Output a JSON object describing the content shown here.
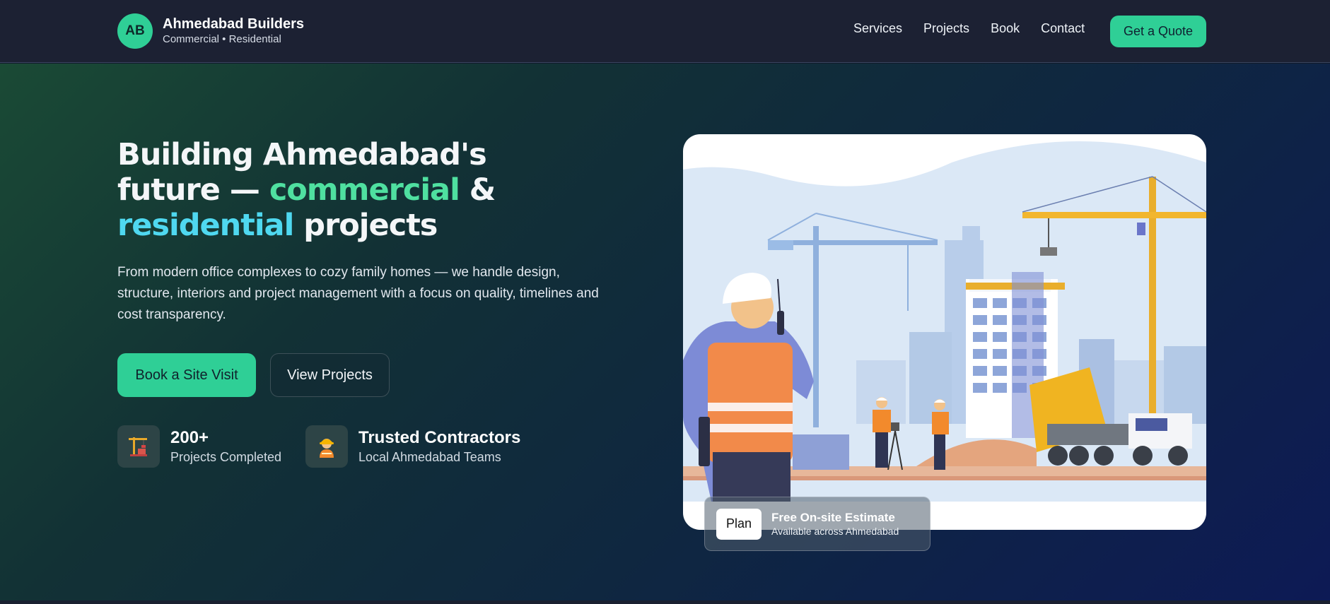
{
  "header": {
    "logo_initials": "AB",
    "brand_name": "Ahmedabad Builders",
    "brand_tagline": "Commercial • Residential",
    "nav": [
      "Services",
      "Projects",
      "Book",
      "Contact"
    ],
    "cta": "Get a Quote"
  },
  "hero": {
    "headline_1": "Building Ahmedabad's",
    "headline_2a": "future — ",
    "headline_2b": "commercial",
    "headline_2c": " &",
    "headline_3a": "residential",
    "headline_3b": " projects",
    "description": "From modern office complexes to cozy family homes — we handle design, structure, interiors and project management with a focus on quality, timelines and cost transparency.",
    "primary_button": "Book a Site Visit",
    "secondary_button": "View Projects",
    "stats": [
      {
        "icon": "construction-crane-icon",
        "value": "200+",
        "label": "Projects Completed"
      },
      {
        "icon": "construction-worker-icon",
        "value": "Trusted Contractors",
        "label": "Local Ahmedabad Teams"
      }
    ]
  },
  "illustration": {
    "icon": "construction-site-illustration"
  },
  "badge": {
    "button": "Plan",
    "title": "Free On-site Estimate",
    "subtitle": "Available across Ahmedabad"
  },
  "colors": {
    "accent_green": "#2fcf96",
    "headline_green": "#4fe0a0",
    "headline_cyan": "#4fd8f0",
    "header_bg": "#1c2133"
  }
}
